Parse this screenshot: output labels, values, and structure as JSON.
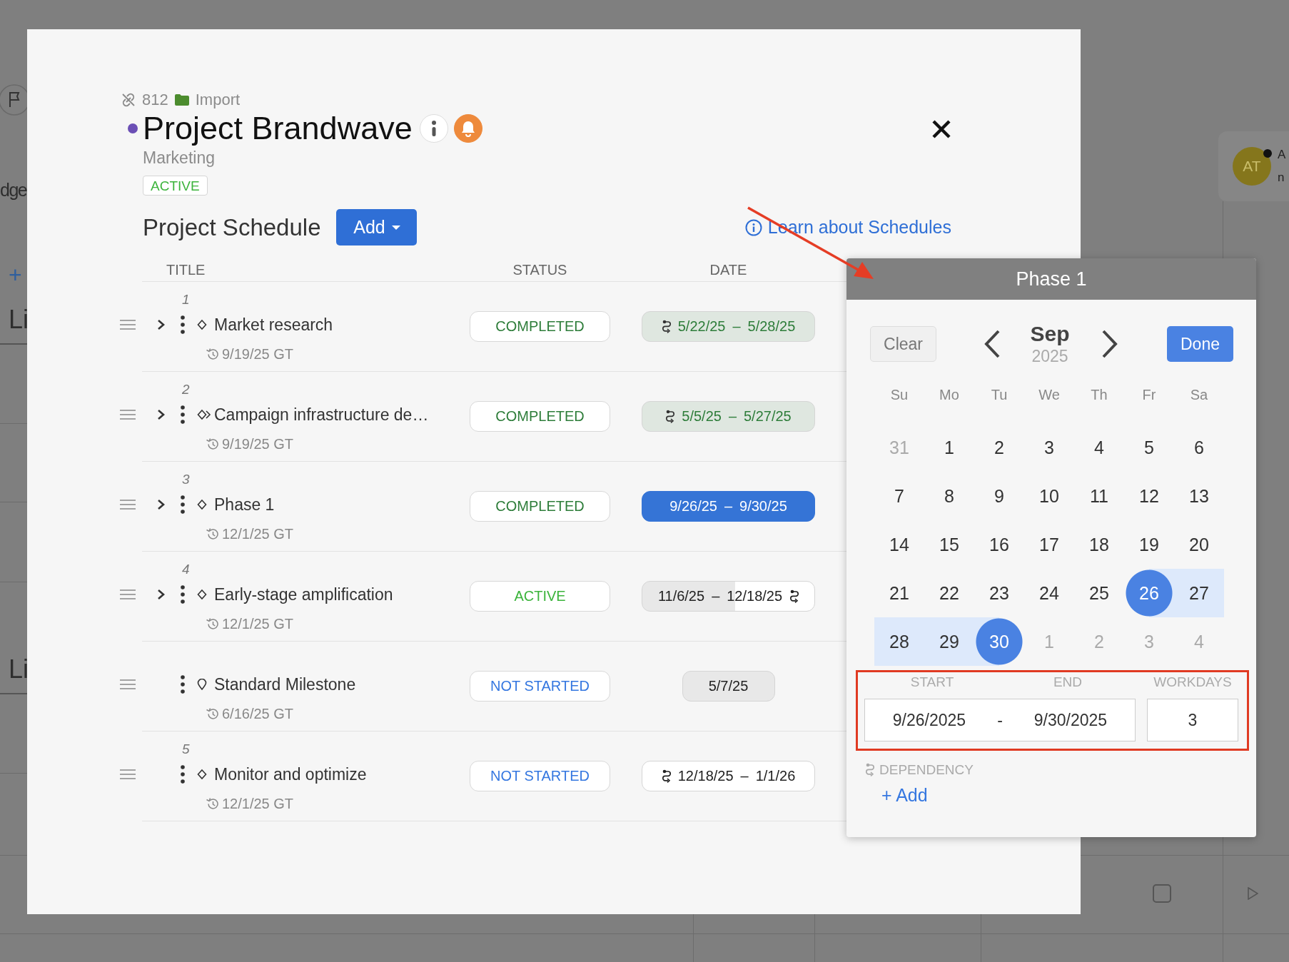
{
  "background": {
    "left_labels": [
      "dge",
      "Li",
      "Li"
    ],
    "add_glyph": "+",
    "avatar": {
      "initials": "AT"
    },
    "right_labels": [
      "A",
      "n"
    ]
  },
  "modal": {
    "breadcrumb": {
      "id": "812",
      "folder": "Import"
    },
    "title": "Project Brandwave",
    "subtitle": "Marketing",
    "status": {
      "label": "ACTIVE",
      "kind": "active"
    },
    "section_title": "Project Schedule",
    "add_button": "Add",
    "help_link": "Learn about Schedules",
    "table": {
      "columns": [
        "TITLE",
        "STATUS",
        "DATE"
      ],
      "rows": [
        {
          "number": "1",
          "title": "Market research",
          "kind": "task",
          "expandable": true,
          "baseline": "9/19/25 GT",
          "status": {
            "label": "COMPLETED",
            "kind": "completed"
          },
          "date": {
            "kind": "completed",
            "dependency_before": true,
            "dependency_after": false,
            "start": "5/22/25",
            "separator": "–",
            "end": "5/28/25"
          }
        },
        {
          "number": "2",
          "title": "Campaign infrastructure de…",
          "kind": "linked_task",
          "expandable": true,
          "baseline": "9/19/25 GT",
          "status": {
            "label": "COMPLETED",
            "kind": "completed"
          },
          "date": {
            "kind": "completed",
            "dependency_before": true,
            "dependency_after": false,
            "start": "5/5/25",
            "separator": "–",
            "end": "5/27/25"
          }
        },
        {
          "number": "3",
          "title": "Phase 1",
          "kind": "task",
          "expandable": true,
          "baseline": "12/1/25 GT",
          "status": {
            "label": "COMPLETED",
            "kind": "completed"
          },
          "date": {
            "kind": "selected",
            "dependency_before": false,
            "dependency_after": false,
            "start": "9/26/25",
            "separator": "–",
            "end": "9/30/25"
          }
        },
        {
          "number": "4",
          "title": "Early-stage amplification",
          "kind": "task",
          "expandable": true,
          "baseline": "12/1/25 GT",
          "status": {
            "label": "ACTIVE",
            "kind": "active"
          },
          "date": {
            "kind": "split",
            "dependency_before": false,
            "dependency_after": true,
            "start": "11/6/25",
            "separator": "–",
            "end": "12/18/25"
          }
        },
        {
          "title": "Standard Milestone",
          "kind": "milestone",
          "expandable": false,
          "baseline": "6/16/25 GT",
          "status": {
            "label": "NOT STARTED",
            "kind": "not_started"
          },
          "date": {
            "kind": "single",
            "dependency_before": false,
            "dependency_after": false,
            "start": "5/7/25"
          }
        },
        {
          "number": "5",
          "title": "Monitor and optimize",
          "kind": "task",
          "expandable": false,
          "baseline": "12/1/25 GT",
          "status": {
            "label": "NOT STARTED",
            "kind": "not_started"
          },
          "date": {
            "kind": "open",
            "dependency_before": true,
            "dependency_after": false,
            "start": "12/18/25",
            "separator": "–",
            "end": "1/1/26"
          }
        }
      ]
    }
  },
  "date_popup": {
    "title": "Phase 1",
    "clear": "Clear",
    "done": "Done",
    "month": "Sep",
    "year": "2025",
    "weekdays": [
      "Su",
      "Mo",
      "Tu",
      "We",
      "Th",
      "Fr",
      "Sa"
    ],
    "weeks": [
      [
        {
          "label": "31",
          "muted": true,
          "in_range": false,
          "selected": false
        },
        {
          "label": "1",
          "muted": false,
          "in_range": false,
          "selected": false
        },
        {
          "label": "2",
          "muted": false,
          "in_range": false,
          "selected": false
        },
        {
          "label": "3",
          "muted": false,
          "in_range": false,
          "selected": false
        },
        {
          "label": "4",
          "muted": false,
          "in_range": false,
          "selected": false
        },
        {
          "label": "5",
          "muted": false,
          "in_range": false,
          "selected": false
        },
        {
          "label": "6",
          "muted": false,
          "in_range": false,
          "selected": false
        }
      ],
      [
        {
          "label": "7",
          "muted": false,
          "in_range": false,
          "selected": false
        },
        {
          "label": "8",
          "muted": false,
          "in_range": false,
          "selected": false
        },
        {
          "label": "9",
          "muted": false,
          "in_range": false,
          "selected": false
        },
        {
          "label": "10",
          "muted": false,
          "in_range": false,
          "selected": false
        },
        {
          "label": "11",
          "muted": false,
          "in_range": false,
          "selected": false
        },
        {
          "label": "12",
          "muted": false,
          "in_range": false,
          "selected": false
        },
        {
          "label": "13",
          "muted": false,
          "in_range": false,
          "selected": false
        }
      ],
      [
        {
          "label": "14",
          "muted": false,
          "in_range": false,
          "selected": false
        },
        {
          "label": "15",
          "muted": false,
          "in_range": false,
          "selected": false
        },
        {
          "label": "16",
          "muted": false,
          "in_range": false,
          "selected": false
        },
        {
          "label": "17",
          "muted": false,
          "in_range": false,
          "selected": false
        },
        {
          "label": "18",
          "muted": false,
          "in_range": false,
          "selected": false
        },
        {
          "label": "19",
          "muted": false,
          "in_range": false,
          "selected": false
        },
        {
          "label": "20",
          "muted": false,
          "in_range": false,
          "selected": false
        }
      ],
      [
        {
          "label": "21",
          "muted": false,
          "in_range": false,
          "selected": false
        },
        {
          "label": "22",
          "muted": false,
          "in_range": false,
          "selected": false
        },
        {
          "label": "23",
          "muted": false,
          "in_range": false,
          "selected": false
        },
        {
          "label": "24",
          "muted": false,
          "in_range": false,
          "selected": false
        },
        {
          "label": "25",
          "muted": false,
          "in_range": false,
          "selected": false
        },
        {
          "label": "26",
          "muted": false,
          "in_range": false,
          "selected": true
        },
        {
          "label": "27",
          "muted": false,
          "in_range": true,
          "selected": false
        }
      ],
      [
        {
          "label": "28",
          "muted": false,
          "in_range": true,
          "selected": false
        },
        {
          "label": "29",
          "muted": false,
          "in_range": true,
          "selected": false
        },
        {
          "label": "30",
          "muted": false,
          "in_range": false,
          "selected": true
        },
        {
          "label": "1",
          "muted": true,
          "in_range": false,
          "selected": false
        },
        {
          "label": "2",
          "muted": true,
          "in_range": false,
          "selected": false
        },
        {
          "label": "3",
          "muted": true,
          "in_range": false,
          "selected": false
        },
        {
          "label": "4",
          "muted": true,
          "in_range": false,
          "selected": false
        }
      ]
    ],
    "fields": {
      "start_label": "START",
      "end_label": "END",
      "workdays_label": "WORKDAYS",
      "start": "9/26/2025",
      "separator": "-",
      "end": "9/30/2025",
      "workdays": "3"
    },
    "dependency": {
      "label": "DEPENDENCY",
      "add": "+ Add"
    }
  }
}
